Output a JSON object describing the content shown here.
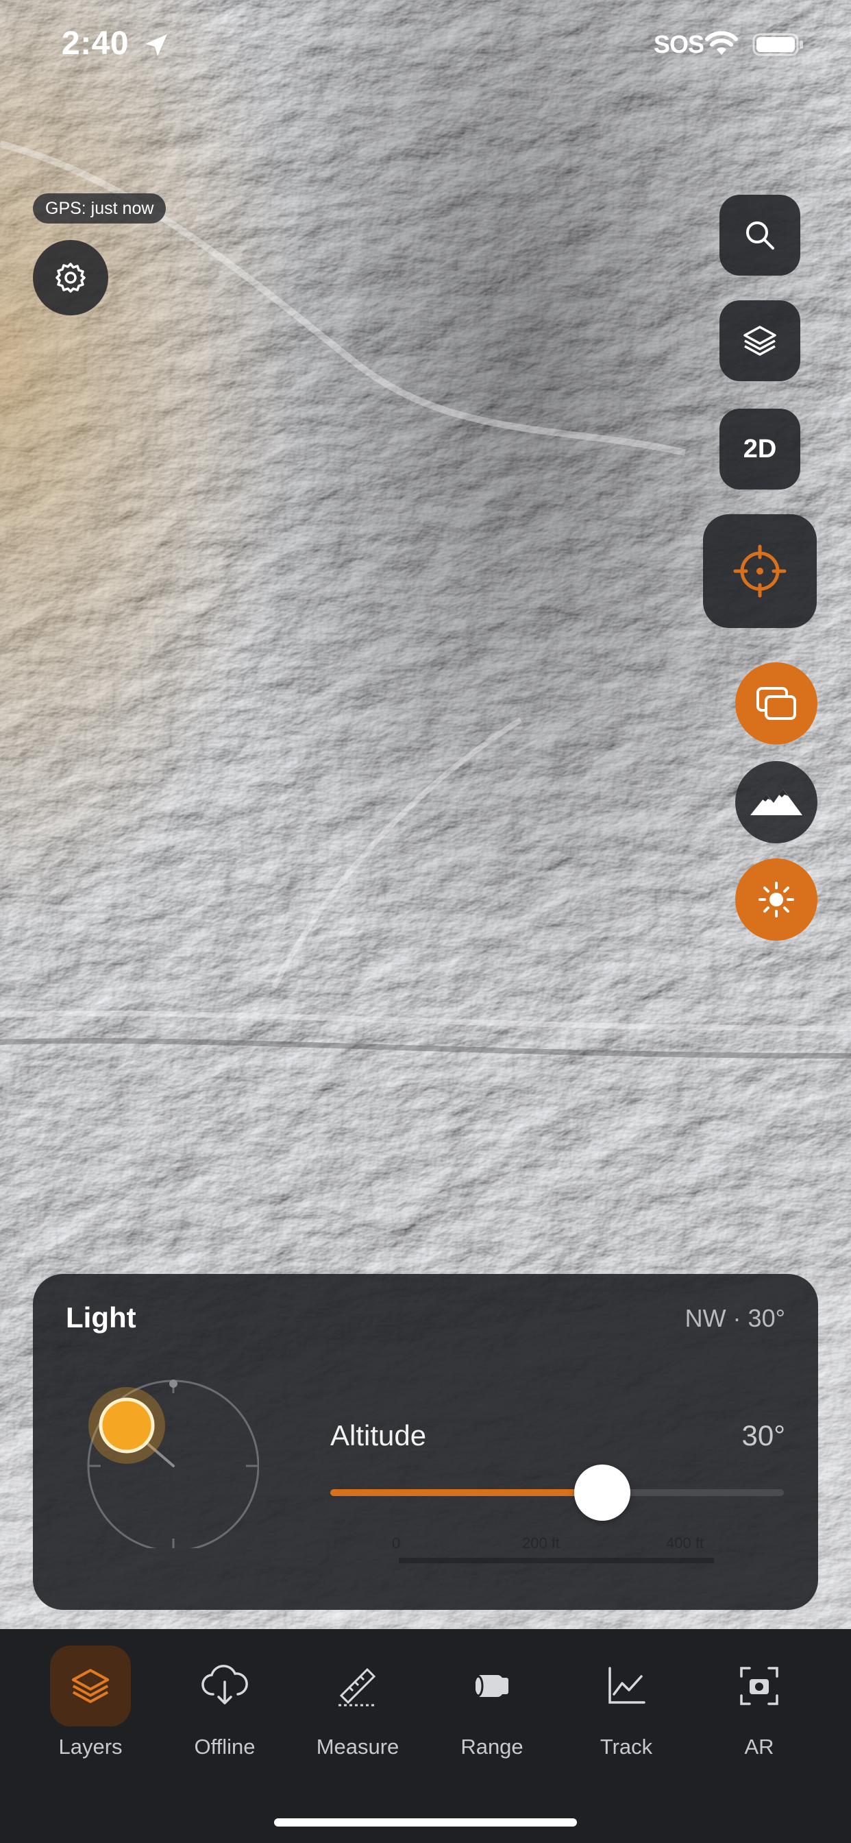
{
  "status_bar": {
    "time": "2:40",
    "sos": "SOS"
  },
  "gps_status": "GPS: just now",
  "map_controls": {
    "mode_toggle": "2D",
    "icons": [
      "settings-icon",
      "search-icon",
      "layers-icon",
      "crosshair-icon",
      "overlay-icon",
      "terrain-icon",
      "sun-icon"
    ]
  },
  "light_panel": {
    "title": "Light",
    "direction": "NW · 30°",
    "altitude_label": "Altitude",
    "altitude_value": "30°",
    "altitude_fraction": 0.6
  },
  "scale_bar": {
    "labels": [
      "0",
      "200 ft",
      "400 ft"
    ]
  },
  "tabs": [
    {
      "label": "Layers",
      "icon": "layers-icon",
      "active": true
    },
    {
      "label": "Offline",
      "icon": "cloud-download-icon",
      "active": false
    },
    {
      "label": "Measure",
      "icon": "ruler-icon",
      "active": false
    },
    {
      "label": "Range",
      "icon": "rangefinder-icon",
      "active": false
    },
    {
      "label": "Track",
      "icon": "chart-icon",
      "active": false
    },
    {
      "label": "AR",
      "icon": "ar-camera-icon",
      "active": false
    }
  ],
  "colors": {
    "accent": "#d9701c",
    "panel": "#222428",
    "sun": "#f5a623"
  }
}
